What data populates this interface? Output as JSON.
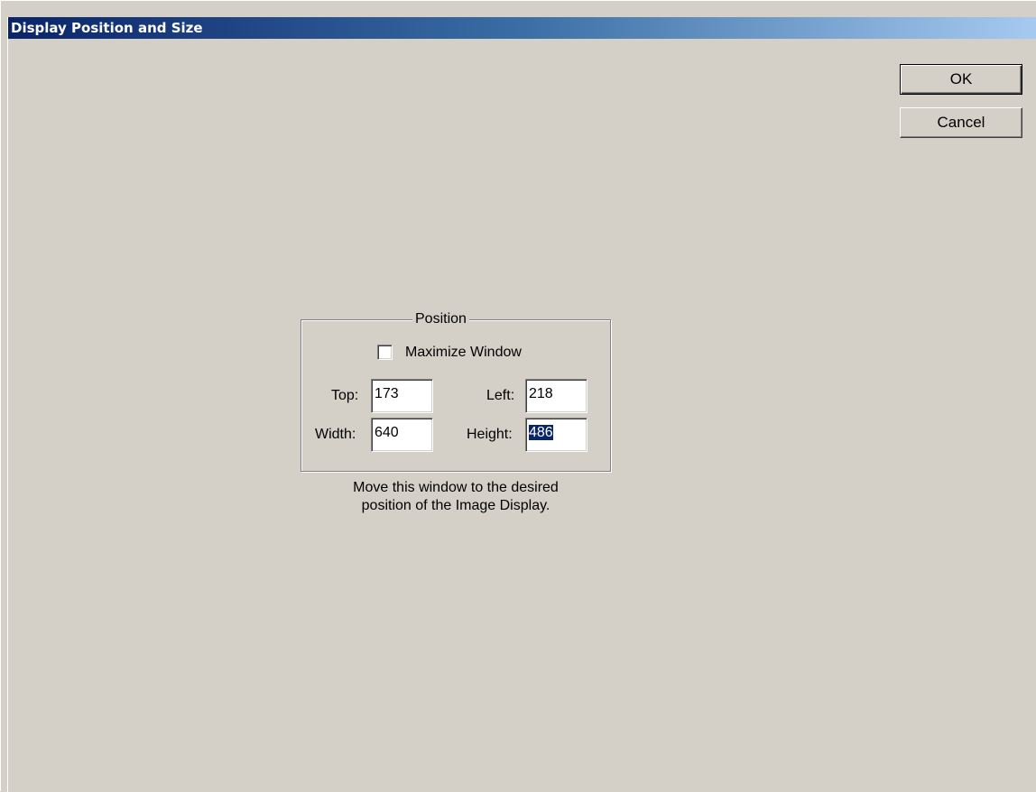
{
  "dialog": {
    "title": "Display Position and Size"
  },
  "buttons": {
    "ok_label": "OK",
    "cancel_label": "Cancel"
  },
  "position_group": {
    "legend": "Position",
    "maximize_label": "Maximize Window",
    "maximize_checked": false,
    "top_label": "Top:",
    "top_value": "173",
    "left_label": "Left:",
    "left_value": "218",
    "width_label": "Width:",
    "width_value": "640",
    "height_label": "Height:",
    "height_value": "486"
  },
  "hint": {
    "line1": "Move this window to the desired",
    "line2": "position of the Image Display."
  },
  "colors": {
    "face": "#d4d0c8",
    "title_gradient_start": "#0a246a",
    "title_gradient_end": "#a6caf0",
    "selection": "#0a246a"
  }
}
